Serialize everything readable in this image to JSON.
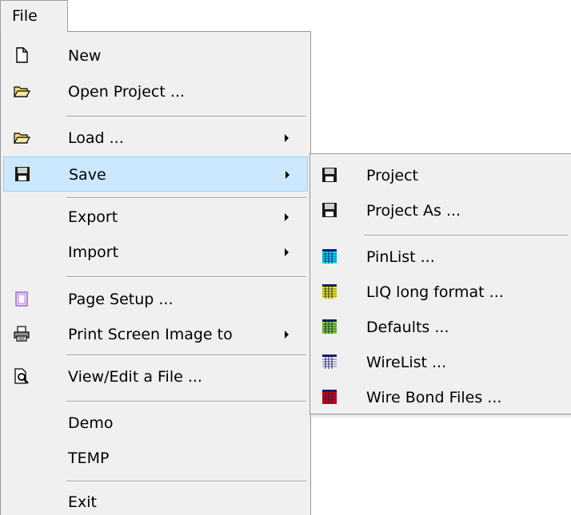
{
  "menubar": {
    "file_label": "File"
  },
  "file_menu": {
    "items": [
      {
        "label": "New",
        "icon": "new-document-icon"
      },
      {
        "label": "Open Project ...",
        "icon": "open-folder-icon"
      },
      {
        "label": "Load ...",
        "icon": "open-folder-icon",
        "submenu": true
      },
      {
        "label": "Save",
        "icon": "floppy-disk-icon",
        "submenu": true,
        "highlighted": true
      },
      {
        "label": "Export",
        "submenu": true
      },
      {
        "label": "Import",
        "submenu": true
      },
      {
        "label": "Page Setup ...",
        "icon": "page-setup-icon"
      },
      {
        "label": "Print Screen Image to",
        "icon": "printer-icon",
        "submenu": true
      },
      {
        "label": "View/Edit a File ...",
        "icon": "view-file-icon"
      },
      {
        "label": "Demo"
      },
      {
        "label": "TEMP"
      },
      {
        "label": "Exit"
      }
    ]
  },
  "save_submenu": {
    "items": [
      {
        "label": "Project",
        "icon": "floppy-disk-icon"
      },
      {
        "label": "Project As ...",
        "icon": "floppy-disk-icon"
      },
      {
        "label": "PinList ...",
        "icon": "grid-icon",
        "color": "#00e5ff"
      },
      {
        "label": "LIQ long format ...",
        "icon": "grid-icon",
        "color": "#ffff00"
      },
      {
        "label": "Defaults ...",
        "icon": "grid-icon",
        "color": "#80e020"
      },
      {
        "label": "WireList ...",
        "icon": "grid-icon",
        "color": "#ffffff"
      },
      {
        "label": "Wire Bond Files ...",
        "icon": "grid-icon",
        "color": "#e00000"
      }
    ]
  },
  "colors": {
    "menu_background": "#f0f0f0",
    "highlight_fill": "#cce8ff",
    "highlight_border": "#99d1ff"
  }
}
